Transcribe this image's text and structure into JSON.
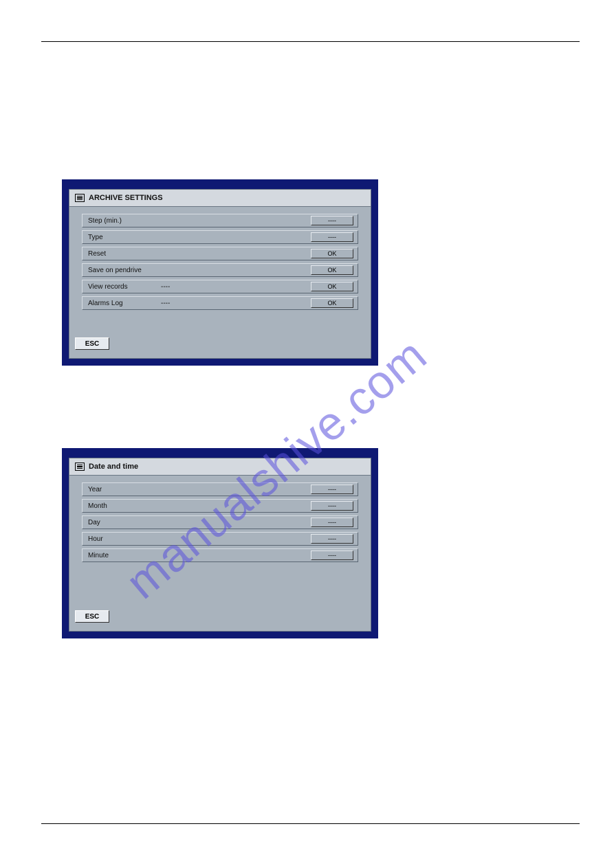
{
  "watermark": "manualshive.com",
  "esc_label": "ESC",
  "panel1": {
    "title": "ARCHIVE SETTINGS",
    "rows": [
      {
        "label": "Step (min.)",
        "mid": "",
        "btn": "----"
      },
      {
        "label": "Type",
        "mid": "",
        "btn": "----"
      },
      {
        "label": "Reset",
        "mid": "",
        "btn": "OK"
      },
      {
        "label": "Save on pendrive",
        "mid": "",
        "btn": "OK"
      },
      {
        "label": "View records",
        "mid": "----",
        "btn": "OK"
      },
      {
        "label": "Alarms Log",
        "mid": "----",
        "btn": "OK"
      }
    ]
  },
  "panel2": {
    "title": "Date and time",
    "rows": [
      {
        "label": "Year",
        "mid": "",
        "btn": "----"
      },
      {
        "label": "Month",
        "mid": "",
        "btn": "----"
      },
      {
        "label": "Day",
        "mid": "",
        "btn": "----"
      },
      {
        "label": "Hour",
        "mid": "",
        "btn": "----"
      },
      {
        "label": "Minute",
        "mid": "",
        "btn": "----"
      }
    ]
  }
}
